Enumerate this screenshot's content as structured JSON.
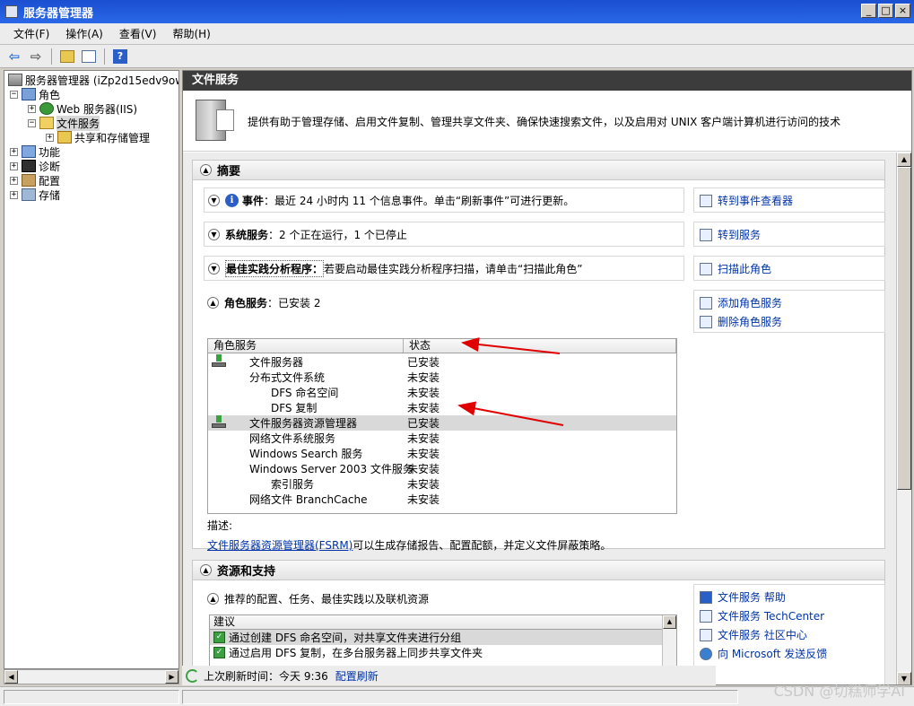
{
  "window": {
    "title": "服务器管理器",
    "buttons": {
      "minimize": "_",
      "maximize": "□",
      "close": "×"
    }
  },
  "menu": {
    "items": [
      "文件(F)",
      "操作(A)",
      "查看(V)",
      "帮助(H)"
    ]
  },
  "toolbar": {
    "back": "⇦",
    "forward": "⇨",
    "help": "?"
  },
  "tree": {
    "root": "服务器管理器 (iZp2d15edv9owo",
    "roles": "角色",
    "web_server": "Web 服务器(IIS)",
    "file_services": "文件服务",
    "share_storage": "共享和存储管理",
    "features": "功能",
    "diagnostics": "诊断",
    "configuration": "配置",
    "storage": "存储"
  },
  "header": {
    "title": "文件服务"
  },
  "description": "提供有助于管理存储、启用文件复制、管理共享文件夹、确保快速搜索文件，以及启用对 UNIX 客户端计算机进行访问的技术",
  "summary": {
    "title": "摘要",
    "events_label": "事件",
    "events_text": "：最近 24 小时内 11 个信息事件。单击“刷新事件”可进行更新。",
    "events_action": "转到事件查看器",
    "services_label": "系统服务",
    "services_text": "：2 个正在运行，1 个已停止",
    "services_action": "转到服务",
    "bpa_label": "最佳实践分析程序：",
    "bpa_text": "若要启动最佳实践分析程序扫描，请单击“扫描此角色”",
    "bpa_action": "扫描此角色",
    "role_services_label": "角色服务",
    "role_services_text": "：已安装 2",
    "add_role_service": "添加角色服务",
    "remove_role_service": "删除角色服务",
    "table_headers": {
      "name": "角色服务",
      "status": "状态"
    },
    "rows": [
      {
        "name": "文件服务器",
        "status": "已安装"
      },
      {
        "name": "分布式文件系统",
        "status": "未安装"
      },
      {
        "name": "DFS 命名空间",
        "status": "未安装"
      },
      {
        "name": "DFS 复制",
        "status": "未安装"
      },
      {
        "name": "文件服务器资源管理器",
        "status": "已安装"
      },
      {
        "name": "网络文件系统服务",
        "status": "未安装"
      },
      {
        "name": "Windows Search 服务",
        "status": "未安装"
      },
      {
        "name": "Windows Server 2003 文件服务",
        "status": "未安装"
      },
      {
        "name": "索引服务",
        "status": "未安装"
      },
      {
        "name": "网络文件 BranchCache",
        "status": "未安装"
      }
    ],
    "description_label": "描述:",
    "fsrm_link": "文件服务器资源管理器(FSRM)",
    "fsrm_text": "可以生成存储报告、配置配额，并定义文件屏蔽策略。"
  },
  "resources": {
    "title": "资源和支持",
    "subtitle": "推荐的配置、任务、最佳实践以及联机资源",
    "list_header": "建议",
    "items": [
      "通过创建 DFS 命名空间，对共享文件夹进行分组",
      "通过启用 DFS 复制，在多台服务器上同步共享文件夹"
    ],
    "links": [
      "文件服务 帮助",
      "文件服务 TechCenter",
      "文件服务 社区中心",
      "向 Microsoft 发送反馈"
    ]
  },
  "refresh": {
    "label": "上次刷新时间：今天 9:36",
    "link": "配置刷新"
  },
  "watermark": "CSDN @切糕师学AI",
  "colors": {
    "title_bar": "#1a4fd0",
    "link": "#0033a8",
    "arrow": "#e00000",
    "header": "#3c3c3c"
  }
}
